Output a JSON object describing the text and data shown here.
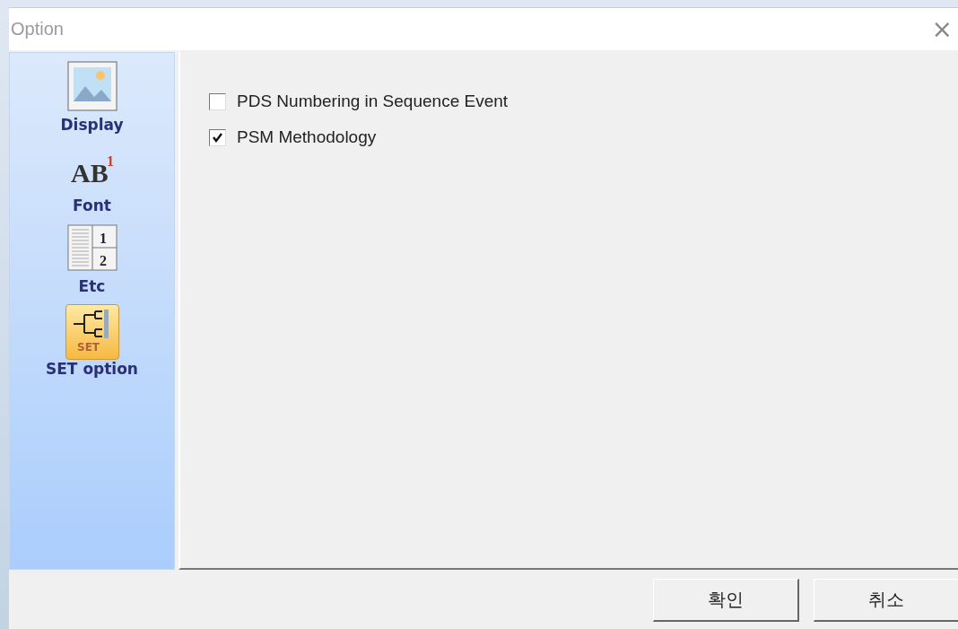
{
  "window": {
    "title": "Option",
    "close": "×"
  },
  "sidebar": {
    "items": [
      {
        "label": "Display",
        "kind": "picture",
        "selected": false
      },
      {
        "label": "Font",
        "kind": "font",
        "icon_text": [
          "AB",
          "1"
        ],
        "selected": false
      },
      {
        "label": "Etc",
        "kind": "pages",
        "icon_text": [
          "1",
          "2"
        ],
        "selected": false
      },
      {
        "label": "SET option",
        "kind": "tree",
        "icon_text": [
          "SET"
        ],
        "selected": true
      }
    ]
  },
  "options": [
    {
      "label": "PDS Numbering in Sequence Event",
      "checked": false
    },
    {
      "label": "PSM Methodology",
      "checked": true
    }
  ],
  "buttons": [
    "확인",
    "취소"
  ]
}
